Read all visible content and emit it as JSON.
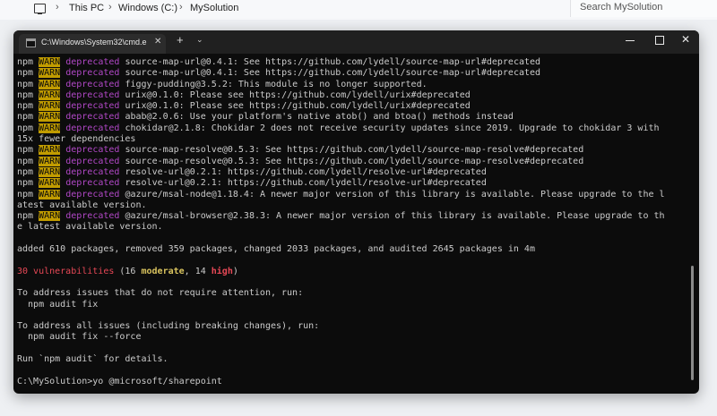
{
  "explorer": {
    "breadcrumb": [
      "This PC",
      "Windows (C:)",
      "MySolution"
    ],
    "search_placeholder": "Search MySolution"
  },
  "terminal": {
    "tab_title": "C:\\Windows\\System32\\cmd.e",
    "close_glyph": "✕",
    "new_tab_glyph": "+",
    "dropdown_glyph": "⌄",
    "win_close_glyph": "✕",
    "deprecations": [
      {
        "text": "source-map-url@0.4.1: See https://github.com/lydell/source-map-url#deprecated"
      },
      {
        "text": "source-map-url@0.4.1: See https://github.com/lydell/source-map-url#deprecated"
      },
      {
        "text": "figgy-pudding@3.5.2: This module is no longer supported."
      },
      {
        "text": "urix@0.1.0: Please see https://github.com/lydell/urix#deprecated"
      },
      {
        "text": "urix@0.1.0: Please see https://github.com/lydell/urix#deprecated"
      },
      {
        "text": "abab@2.0.6: Use your platform's native atob() and btoa() methods instead"
      },
      {
        "text": "chokidar@2.1.8: Chokidar 2 does not receive security updates since 2019. Upgrade to chokidar 3 with",
        "cont": "15x fewer dependencies"
      },
      {
        "text": "source-map-resolve@0.5.3: See https://github.com/lydell/source-map-resolve#deprecated"
      },
      {
        "text": "source-map-resolve@0.5.3: See https://github.com/lydell/source-map-resolve#deprecated"
      },
      {
        "text": "resolve-url@0.2.1: https://github.com/lydell/resolve-url#deprecated"
      },
      {
        "text": "resolve-url@0.2.1: https://github.com/lydell/resolve-url#deprecated"
      },
      {
        "text": "@azure/msal-node@1.18.4: A newer major version of this library is available. Please upgrade to the l",
        "cont": "atest available version."
      },
      {
        "text": "@azure/msal-browser@2.38.3: A newer major version of this library is available. Please upgrade to th",
        "cont": "e latest available version."
      }
    ],
    "npm_label": "npm",
    "warn_label": "WARN",
    "deprecated_label": "deprecated",
    "added_line": "added 610 packages, removed 359 packages, changed 2033 packages, and audited 2645 packages in 4m",
    "vuln_count": "30 vulnerabilities",
    "vuln_open": " (16 ",
    "vuln_moderate": "moderate",
    "vuln_mid": ", 14 ",
    "vuln_high": "high",
    "vuln_close": ")",
    "address_line1": "To address issues that do not require attention, run:",
    "address_cmd1": "  npm audit fix",
    "address_line2": "To address all issues (including breaking changes), run:",
    "address_cmd2": "  npm audit fix --force",
    "run_audit": "Run `npm audit` for details.",
    "prompt": "C:\\MySolution>yo @microsoft/sharepoint",
    "colors": {
      "warn_bg": "#c19c00",
      "deprecated": "#b148c6",
      "error_red": "#e74856",
      "moderate": "#d9c35e"
    }
  }
}
